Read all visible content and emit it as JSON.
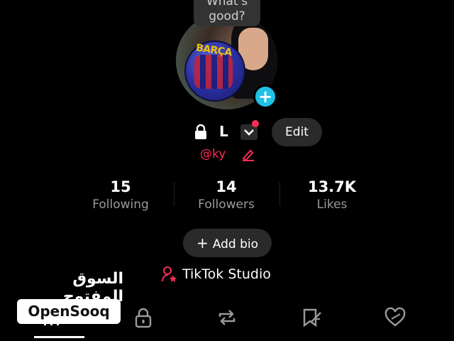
{
  "tooltip": {
    "text": "What's good?"
  },
  "avatar": {
    "ball_text": "BARÇA"
  },
  "profile": {
    "name": "L",
    "handle": "@ky",
    "edit_label": "Edit"
  },
  "stats": [
    {
      "value": "15",
      "label": "Following"
    },
    {
      "value": "14",
      "label": "Followers"
    },
    {
      "value": "13.7K",
      "label": "Likes"
    }
  ],
  "bio": {
    "add_label": "Add bio"
  },
  "studio": {
    "label": "TikTok Studio"
  },
  "watermark": {
    "arabic": "السوق المفتوح",
    "brand": "OpenSooq"
  },
  "colors": {
    "accent_red": "#fe2c55",
    "accent_cyan": "#1fc1e6",
    "button_bg": "#2a2a2a"
  },
  "tabs": [
    {
      "icon": "grid-icon"
    },
    {
      "icon": "lock-icon"
    },
    {
      "icon": "repost-icon"
    },
    {
      "icon": "bookmark-icon"
    },
    {
      "icon": "heart-icon"
    }
  ]
}
